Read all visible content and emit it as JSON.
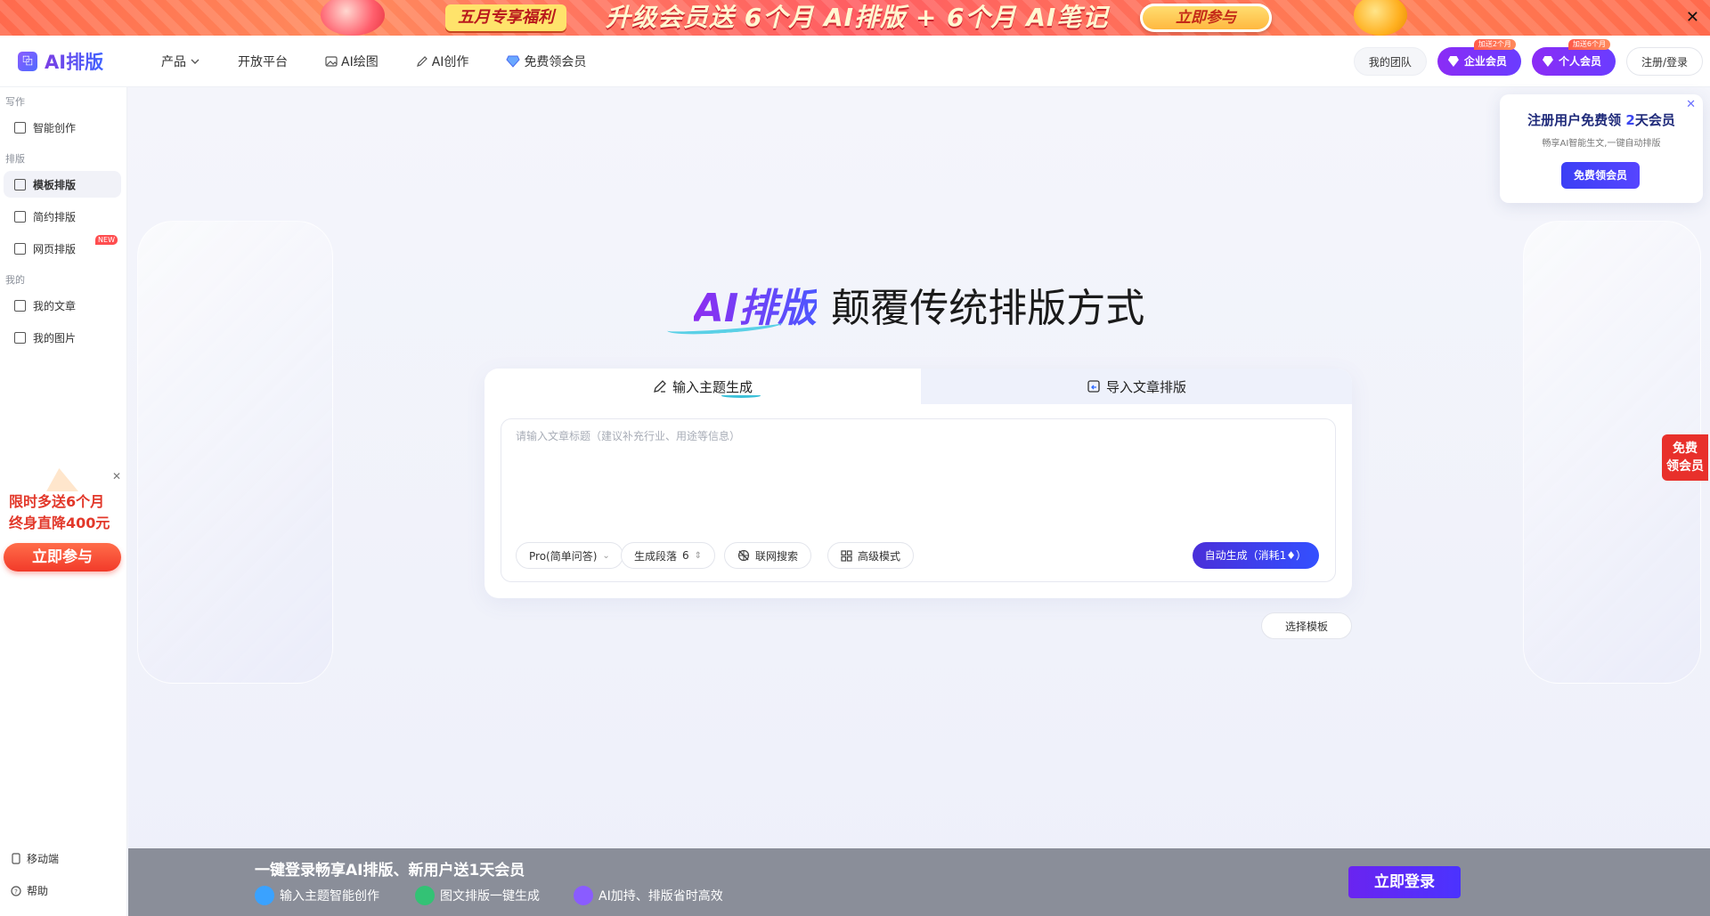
{
  "promo": {
    "tag": "五月专享福利",
    "headline": "升级会员送 6个月 AI排版 + 6个月 AI笔记",
    "join": "立即参与",
    "close": "✕"
  },
  "nav": {
    "logo_mark": "⿻",
    "logo": "AI排版",
    "items": [
      {
        "label": "产品"
      },
      {
        "label": "开放平台"
      },
      {
        "label": "AI绘图"
      },
      {
        "label": "AI创作"
      },
      {
        "label": "免费领会员"
      }
    ],
    "team": "我的团队",
    "enterprise": {
      "label": "企业会员",
      "badge": "加送2个月"
    },
    "personal": {
      "label": "个人会员",
      "badge": "加送6个月"
    },
    "login": "注册/登录"
  },
  "sidebar": {
    "sections": [
      "写作",
      "排版",
      "我的"
    ],
    "items": [
      {
        "label": "智能创作"
      },
      {
        "label": "模板排版"
      },
      {
        "label": "简约排版"
      },
      {
        "label": "网页排版",
        "badge": "NEW"
      },
      {
        "label": "我的文章"
      },
      {
        "label": "我的图片"
      }
    ],
    "promo": {
      "line1": "限时多送6个月",
      "line2": "终身直降400元",
      "button": "立即参与"
    },
    "mobile": "移动端",
    "help": "帮助"
  },
  "hero": {
    "ai": "AI排版",
    "rest": "颠覆传统排版方式"
  },
  "editor": {
    "tabs": [
      "输入主题生成",
      "导入文章排版"
    ],
    "placeholder": "请输入文章标题（建议补充行业、用途等信息）",
    "options": {
      "model": "Pro(简单问答)",
      "paragraphs_label": "生成段落",
      "paragraphs_value": "6",
      "web_search": "联网搜索",
      "advanced": "高级模式"
    },
    "generate": "自动生成（消耗1♦）"
  },
  "template_button": "选择模板",
  "popup": {
    "title_prefix": "注册用户免费领 ",
    "title_num": "2",
    "title_suffix": "天会员",
    "sub": "畅享AI智能生文,一键自动排版",
    "button": "免费领会员"
  },
  "float": {
    "line1": "免费",
    "line2": "领会员"
  },
  "bottom": {
    "headline": "一键登录畅享AI排版、新用户送1天会员",
    "features": [
      "输入主题智能创作",
      "图文排版一键生成",
      "AI加持、排版省时高效"
    ],
    "button": "立即登录"
  }
}
